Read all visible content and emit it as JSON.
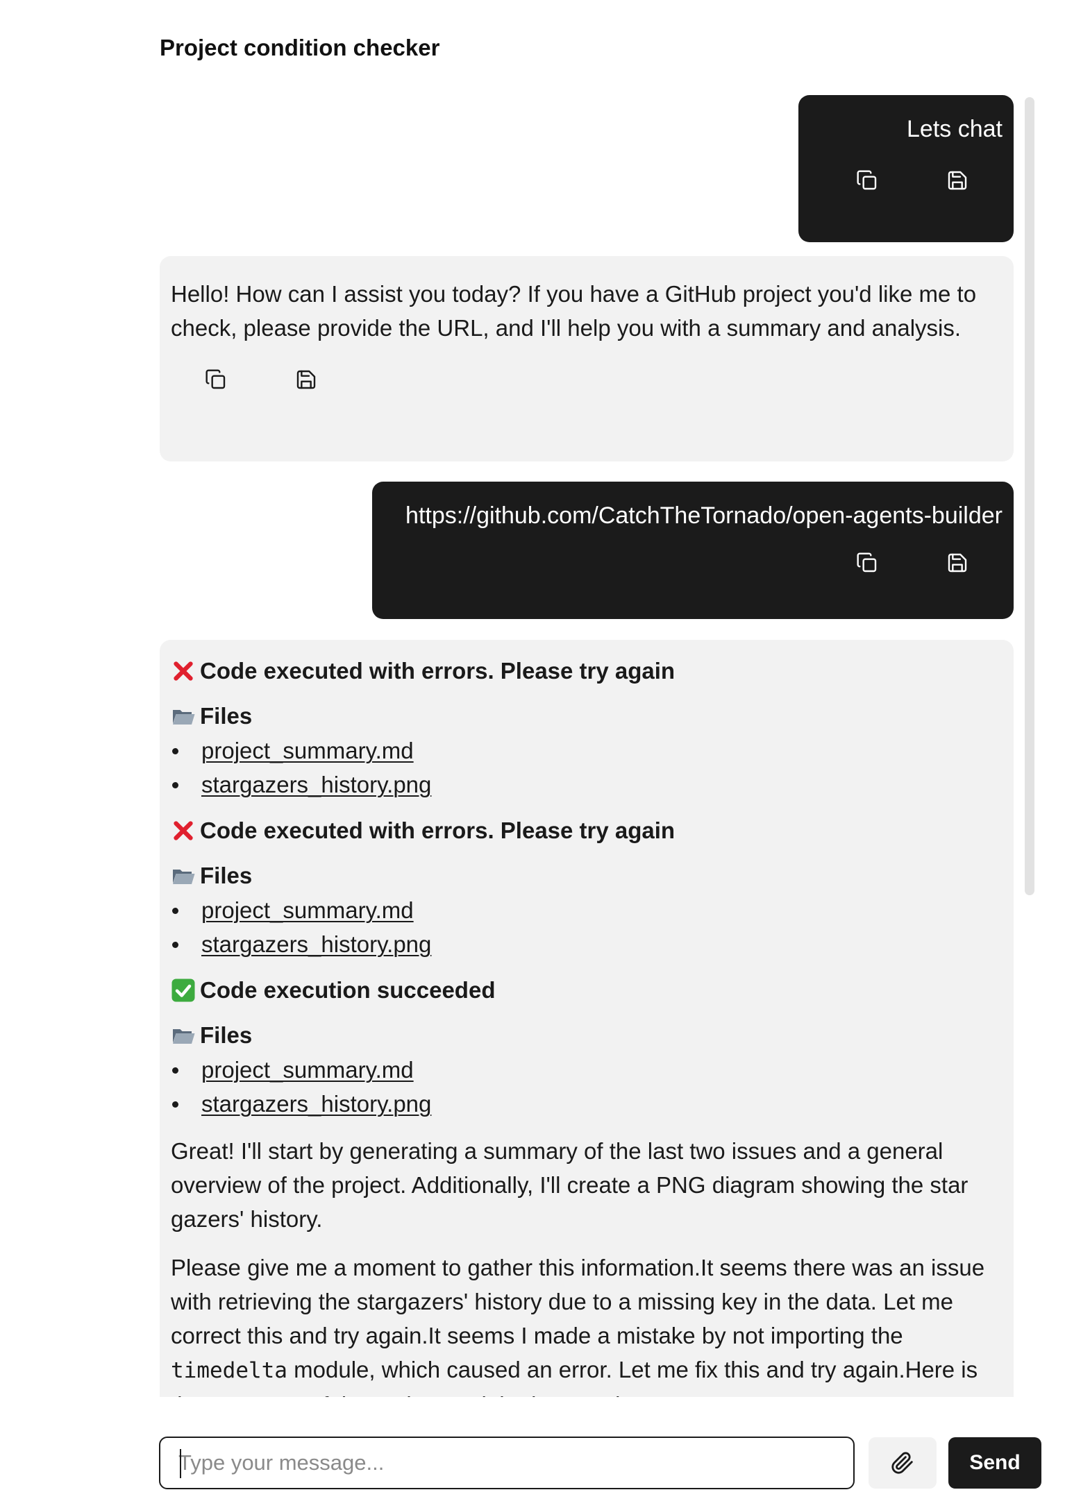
{
  "header": {
    "title": "Project condition checker"
  },
  "messages": {
    "m1": {
      "text": "Lets chat"
    },
    "m2": {
      "text": "Hello! How can I assist you today? If you have a GitHub project you'd like me to check, please provide the URL, and I'll help you with a summary and analysis."
    },
    "m3": {
      "text": "https://github.com/CatchTheTornado/open-agents-builder"
    },
    "m4": {
      "blocks": [
        {
          "status": "Code executed with errors. Please try again",
          "status_icon": "cross-mark-icon",
          "files_label": "Files",
          "files": [
            "project_summary.md",
            "stargazers_history.png"
          ]
        },
        {
          "status": "Code executed with errors. Please try again",
          "status_icon": "cross-mark-icon",
          "files_label": "Files",
          "files": [
            "project_summary.md",
            "stargazers_history.png"
          ]
        },
        {
          "status": "Code execution succeeded",
          "status_icon": "check-mark-icon",
          "files_label": "Files",
          "files": [
            "project_summary.md",
            "stargazers_history.png"
          ]
        }
      ],
      "para1": "Great! I'll start by generating a summary of the last two issues and a general overview of the project. Additionally, I'll create a PNG diagram showing the star gazers' history.",
      "para2_a": "Please give me a moment to gather this information.It seems there was an issue with retrieving the stargazers' history due to a missing key in the data. Let me correct this and try again.It seems I made a mistake by not importing the ",
      "para2_code": "timedelta",
      "para2_b": " module, which caused an error. Let me fix this and try again.Here is the summary of the project and the last two issues:"
    }
  },
  "composer": {
    "placeholder": "Type your message...",
    "send_label": "Send"
  },
  "colors": {
    "user_bubble": "#1b1b1b",
    "bot_bubble": "#f2f2f2",
    "error": "#e0202e",
    "success": "#3dab3f"
  }
}
